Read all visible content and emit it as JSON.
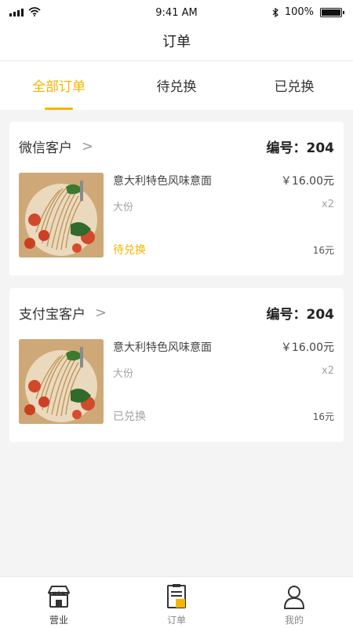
{
  "status_bar": {
    "time": "9:41 AM",
    "battery": "100%"
  },
  "nav": {
    "title": "订单"
  },
  "tabs": [
    {
      "label": "全部订单",
      "active": true
    },
    {
      "label": "待兑换",
      "active": false
    },
    {
      "label": "已兑换",
      "active": false
    }
  ],
  "orders": [
    {
      "customer": "微信客户",
      "chevron": ">",
      "order_no": "编号：204",
      "item": {
        "name": "意大利特色风味意面",
        "price": "￥16.00元",
        "size": "大份",
        "qty": "x2",
        "status": "待兑换",
        "total": "16元"
      }
    },
    {
      "customer": "支付宝客户",
      "chevron": ">",
      "order_no": "编号：204",
      "item": {
        "name": "意大利特色风味意面",
        "price": "￥16.00元",
        "size": "大份",
        "qty": "x2",
        "status": "已兑换",
        "total": "16元"
      }
    }
  ],
  "bottom_nav": [
    {
      "label": "营业",
      "icon": "store-icon"
    },
    {
      "label": "订单",
      "icon": "order-list-icon"
    },
    {
      "label": "我的",
      "icon": "user-icon"
    }
  ],
  "colors": {
    "accent": "#f5b400",
    "muted": "#a2a2a2",
    "background": "#f4f4f4"
  }
}
